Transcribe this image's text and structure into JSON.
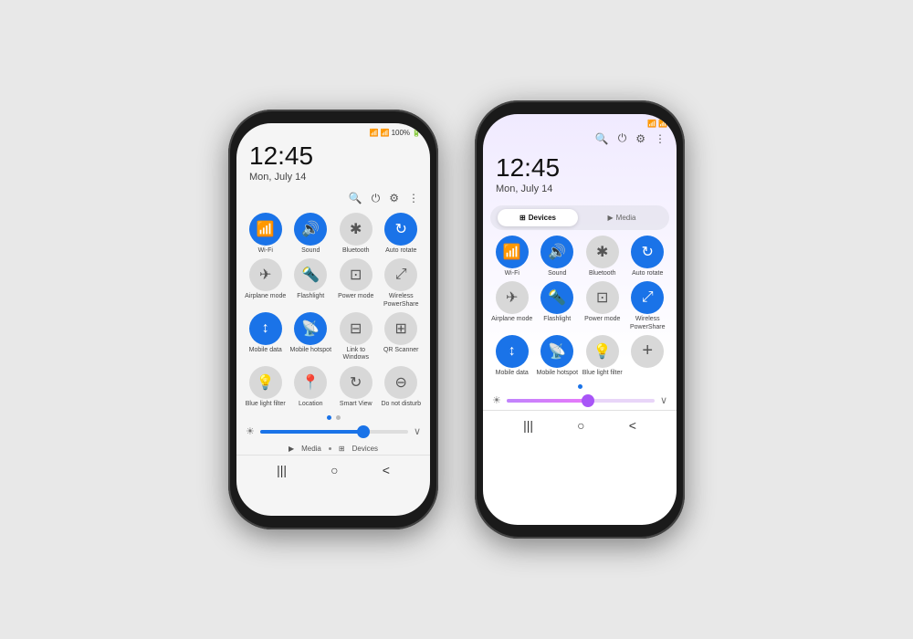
{
  "phone_left": {
    "status": {
      "wifi": "📶",
      "signal": "📶",
      "battery": "100%"
    },
    "time": "12:45",
    "date": "Mon, July 14",
    "toolbar": {
      "search": "🔍",
      "power": "⏻",
      "settings": "⚙",
      "more": "⋮"
    },
    "tiles": [
      {
        "label": "Wi-Fi",
        "active": true,
        "icon": "📶"
      },
      {
        "label": "Sound",
        "active": true,
        "icon": "🔊"
      },
      {
        "label": "Bluetooth",
        "active": false,
        "icon": "❄"
      },
      {
        "label": "Auto\nrotate",
        "active": true,
        "icon": "🔄"
      },
      {
        "label": "Airplane\nmode",
        "active": false,
        "icon": "✈"
      },
      {
        "label": "Flashlight",
        "active": false,
        "icon": "🔦"
      },
      {
        "label": "Power\nmode",
        "active": false,
        "icon": "🔋"
      },
      {
        "label": "Wireless\nPowerShare",
        "active": false,
        "icon": "📡"
      },
      {
        "label": "Mobile\ndata",
        "active": true,
        "icon": "↕"
      },
      {
        "label": "Mobile\nhotspot",
        "active": true,
        "icon": "📶"
      },
      {
        "label": "Link to\nWindows",
        "active": false,
        "icon": "🖥"
      },
      {
        "label": "QR Scanner",
        "active": false,
        "icon": "⊞"
      },
      {
        "label": "Blue light\nfilter",
        "active": false,
        "icon": "💡"
      },
      {
        "label": "Location",
        "active": false,
        "icon": "📍"
      },
      {
        "label": "Smart View",
        "active": false,
        "icon": "🔄"
      },
      {
        "label": "Do not\ndisturb",
        "active": false,
        "icon": "⊖"
      }
    ],
    "brightness": 70,
    "bottom_bar": {
      "media_label": "Media",
      "devices_label": "Devices"
    },
    "nav": {
      "recent": "|||",
      "home": "○",
      "back": "<"
    }
  },
  "phone_right": {
    "status": {
      "wifi": "📶",
      "signal": "📶"
    },
    "toolbar": {
      "search": "🔍",
      "power": "⏻",
      "settings": "⚙",
      "more": "⋮"
    },
    "time": "12:45",
    "date": "Mon, July 14",
    "tabs": {
      "devices_label": "Devices",
      "media_label": "Media"
    },
    "tiles": [
      {
        "label": "Wi-Fi",
        "active": true,
        "icon": "📶"
      },
      {
        "label": "Sound",
        "active": true,
        "icon": "🔊"
      },
      {
        "label": "Bluetooth",
        "active": false,
        "icon": "❄"
      },
      {
        "label": "Auto\nrotate",
        "active": true,
        "icon": "🔄"
      },
      {
        "label": "Airplane\nmode",
        "active": false,
        "icon": "✈"
      },
      {
        "label": "Flashlight",
        "active": true,
        "icon": "🔦"
      },
      {
        "label": "Power\nmode",
        "active": false,
        "icon": "🔋"
      },
      {
        "label": "Wireless\nPowerShare",
        "active": true,
        "icon": "📡"
      },
      {
        "label": "Mobile\ndata",
        "active": true,
        "icon": "↕"
      },
      {
        "label": "Mobile\nhotspot",
        "active": true,
        "icon": "📶"
      },
      {
        "label": "Blue light\nfilter",
        "active": false,
        "icon": "💡"
      },
      {
        "label": "+",
        "active": false,
        "icon": "+"
      }
    ],
    "brightness": 55,
    "nav": {
      "recent": "|||",
      "home": "○",
      "back": "<"
    }
  }
}
